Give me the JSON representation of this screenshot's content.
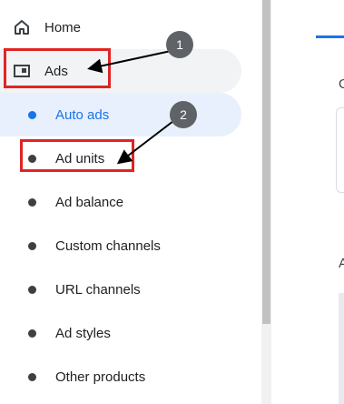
{
  "sidebar": {
    "home_label": "Home",
    "ads_label": "Ads",
    "items": [
      {
        "label": "Auto ads",
        "active": true
      },
      {
        "label": "Ad units",
        "active": false
      },
      {
        "label": "Ad balance",
        "active": false
      },
      {
        "label": "Custom channels",
        "active": false
      },
      {
        "label": "URL channels",
        "active": false
      },
      {
        "label": "Ad styles",
        "active": false
      },
      {
        "label": "Other products",
        "active": false
      }
    ]
  },
  "main": {
    "heading_letter_1": "G",
    "heading_letter_2": "A"
  },
  "annotations": {
    "badge_1": "1",
    "badge_2": "2"
  },
  "colors": {
    "accent": "#1a73e8",
    "highlight": "#e02424",
    "badge": "#5f6368"
  }
}
